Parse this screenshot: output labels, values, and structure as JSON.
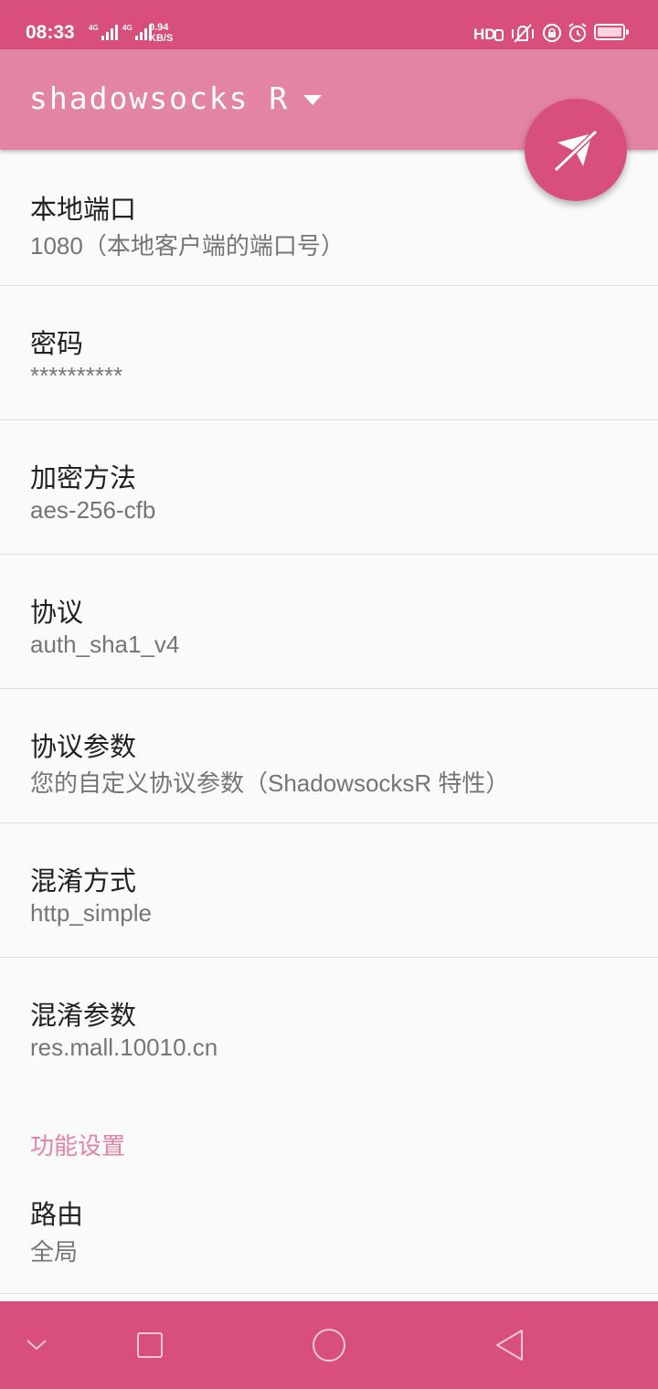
{
  "status_bar": {
    "time": "08:33",
    "sim1_label": "4G",
    "sim2_label": "4G",
    "speed_value": "0.94",
    "speed_unit": "KB/S",
    "battery_level": 1.0,
    "icons": [
      "hd-icon",
      "vibrate-icon",
      "lock-rotation-icon",
      "alarm-icon",
      "battery-icon"
    ]
  },
  "app_bar": {
    "title": "shadowsocks R",
    "dropdown_icon": "chevron-down-icon"
  },
  "fab": {
    "icon": "plane-off-icon"
  },
  "preferences": [
    {
      "title": "本地端口",
      "summary": "1080（本地客户端的端口号）"
    },
    {
      "title": "密码",
      "summary": "**********"
    },
    {
      "title": "加密方法",
      "summary": "aes-256-cfb"
    },
    {
      "title": "协议",
      "summary": "auth_sha1_v4"
    },
    {
      "title": "协议参数",
      "summary": "您的自定义协议参数（ShadowsocksR 特性）"
    },
    {
      "title": "混淆方式",
      "summary": "http_simple"
    },
    {
      "title": "混淆参数",
      "summary": "res.mall.10010.cn"
    }
  ],
  "feature_section": {
    "header": "功能设置",
    "route": {
      "title": "路由",
      "summary": "全局"
    }
  },
  "nav_bar": {
    "icons": [
      "chevron-down-icon",
      "square-icon",
      "circle-icon",
      "triangle-back-icon"
    ]
  },
  "colors": {
    "status_bar": "#d84f7b",
    "app_bar": "#e384a3",
    "accent": "#d84f7b",
    "section_header": "#e384a3"
  }
}
